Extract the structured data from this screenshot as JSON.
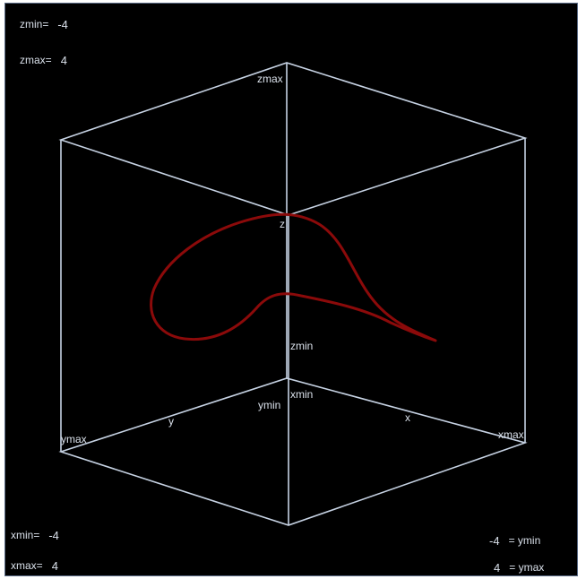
{
  "readouts": {
    "zmin": {
      "label": "zmin=",
      "value": "-4"
    },
    "zmax": {
      "label": "zmax=",
      "value": "4"
    },
    "xmin": {
      "label": "xmin=",
      "value": "-4"
    },
    "xmax": {
      "label": "xmax=",
      "value": "4"
    },
    "ymin": {
      "value": "-4",
      "label": "= ymin"
    },
    "ymax": {
      "value": "4",
      "label": "= ymax"
    }
  },
  "axis_labels": {
    "zmax": "zmax",
    "zmin": "zmin",
    "z": "z",
    "ymax": "ymax",
    "y": "y",
    "ymin": "ymin",
    "xmin": "xmin",
    "x": "x",
    "xmax": "xmax"
  },
  "colors": {
    "background": "#000000",
    "box_edges": "#c6d2e3",
    "curve": "#8b0a0a",
    "text": "#d9e0ea"
  }
}
